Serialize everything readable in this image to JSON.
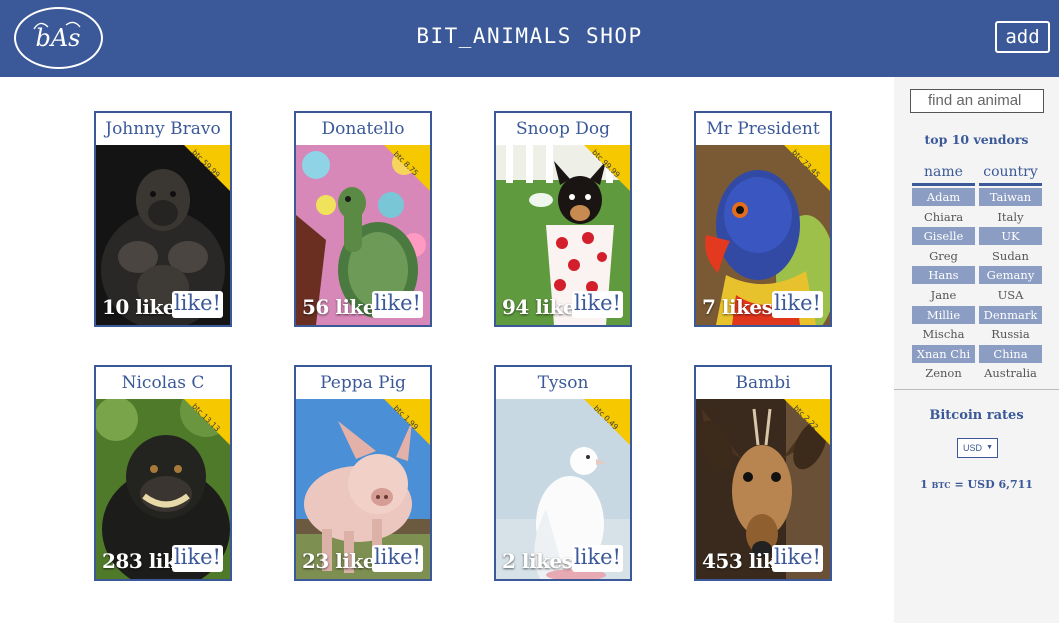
{
  "header": {
    "logo_text": "bAs",
    "title": "BIT_ANIMALS SHOP",
    "add_label": "add"
  },
  "colors": {
    "brand": "#3b5998",
    "highlight_row": "#8b9dc3",
    "price_ribbon": "#f5c800"
  },
  "cards": [
    {
      "name": "Johnny Bravo",
      "price": "btc 59.99",
      "likes": "10 likes",
      "like_label": "like!",
      "photo": "gorilla"
    },
    {
      "name": "Donatello",
      "price": "btc 8.75",
      "likes": "56 likes",
      "like_label": "like!",
      "photo": "turtle"
    },
    {
      "name": "Snoop Dog",
      "price": "btc 99.99",
      "likes": "94 likes",
      "like_label": "like!",
      "photo": "puppy-in-cup"
    },
    {
      "name": "Mr President",
      "price": "btc 73.45",
      "likes": "7 likes",
      "like_label": "like!",
      "photo": "parrot"
    },
    {
      "name": "Nicolas C",
      "price": "btc 13.13",
      "likes": "283 likes",
      "like_label": "like!",
      "photo": "monkey"
    },
    {
      "name": "Peppa Pig",
      "price": "btc 1.99",
      "likes": "23 likes",
      "like_label": "like!",
      "photo": "pig"
    },
    {
      "name": "Tyson",
      "price": "btc 0.49",
      "likes": "2 likes",
      "like_label": "like!",
      "photo": "dove"
    },
    {
      "name": "Bambi",
      "price": "btc 2.22",
      "likes": "453 likes",
      "like_label": "like!",
      "photo": "antelope"
    }
  ],
  "sidebar": {
    "search_placeholder": "find an animal",
    "vendors_title": "top 10 vendors",
    "columns": [
      "name",
      "country"
    ],
    "vendors": [
      {
        "name": "Adam",
        "country": "Taiwan"
      },
      {
        "name": "Chiara",
        "country": "Italy"
      },
      {
        "name": "Giselle",
        "country": "UK"
      },
      {
        "name": "Greg",
        "country": "Sudan"
      },
      {
        "name": "Hans",
        "country": "Gemany"
      },
      {
        "name": "Jane",
        "country": "USA"
      },
      {
        "name": "Millie",
        "country": "Denmark"
      },
      {
        "name": "Mischa",
        "country": "Russia"
      },
      {
        "name": "Xnan Chi",
        "country": "China"
      },
      {
        "name": "Zenon",
        "country": "Australia"
      }
    ],
    "btc_title": "Bitcoin rates",
    "currency_selected": "USD",
    "rate_prefix": "1",
    "rate_unit": "BTC",
    "rate_value": "= USD 6,711"
  }
}
